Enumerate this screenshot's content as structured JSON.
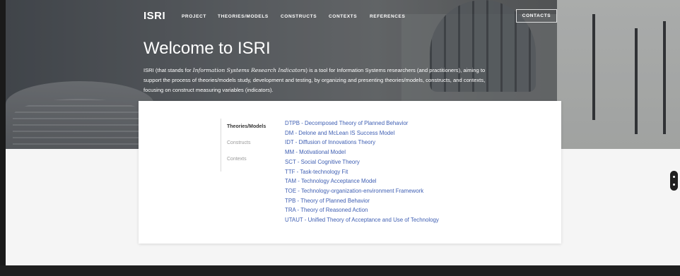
{
  "nav": {
    "logo": "ISRI",
    "links": [
      "PROJECT",
      "THEORIES/MODELS",
      "CONSTRUCTS",
      "CONTEXTS",
      "REFERENCES"
    ],
    "contacts": "CONTACTS"
  },
  "hero": {
    "title": "Welcome to ISRI",
    "desc_prefix": "ISRI (that stands for ",
    "desc_em": "Information Systems Research Indicators",
    "desc_suffix": ") is a tool for Information Systems researchers (and practitioners), aiming to support the process of theories/models study, development and testing, by organizing and presenting theories/models, constructs, and contexts, focusing on construct measuring variables (indicators)."
  },
  "sidebar": {
    "items": [
      "Theories/Models",
      "Constructs",
      "Contexts"
    ],
    "active_index": 0
  },
  "theories": [
    "DTPB - Decomposed Theory of Planned Behavior",
    "DM - Delone and McLean IS Success Model",
    "IDT - Diffusion of Innovations Theory",
    "MM - Motivational Model",
    "SCT - Social Cognitive Theory",
    "TTF - Task-technology Fit",
    "TAM - Technology Acceptance Model",
    "TOE - Technology-organization-environment Framework",
    "TPB - Theory of Planned Behavior",
    "TRA - Theory of Reasoned Action",
    "UTAUT - Unified Theory of Acceptance and Use of Technology"
  ],
  "colors": {
    "link": "#3f5fb3",
    "footer": "#1f1f1f"
  }
}
